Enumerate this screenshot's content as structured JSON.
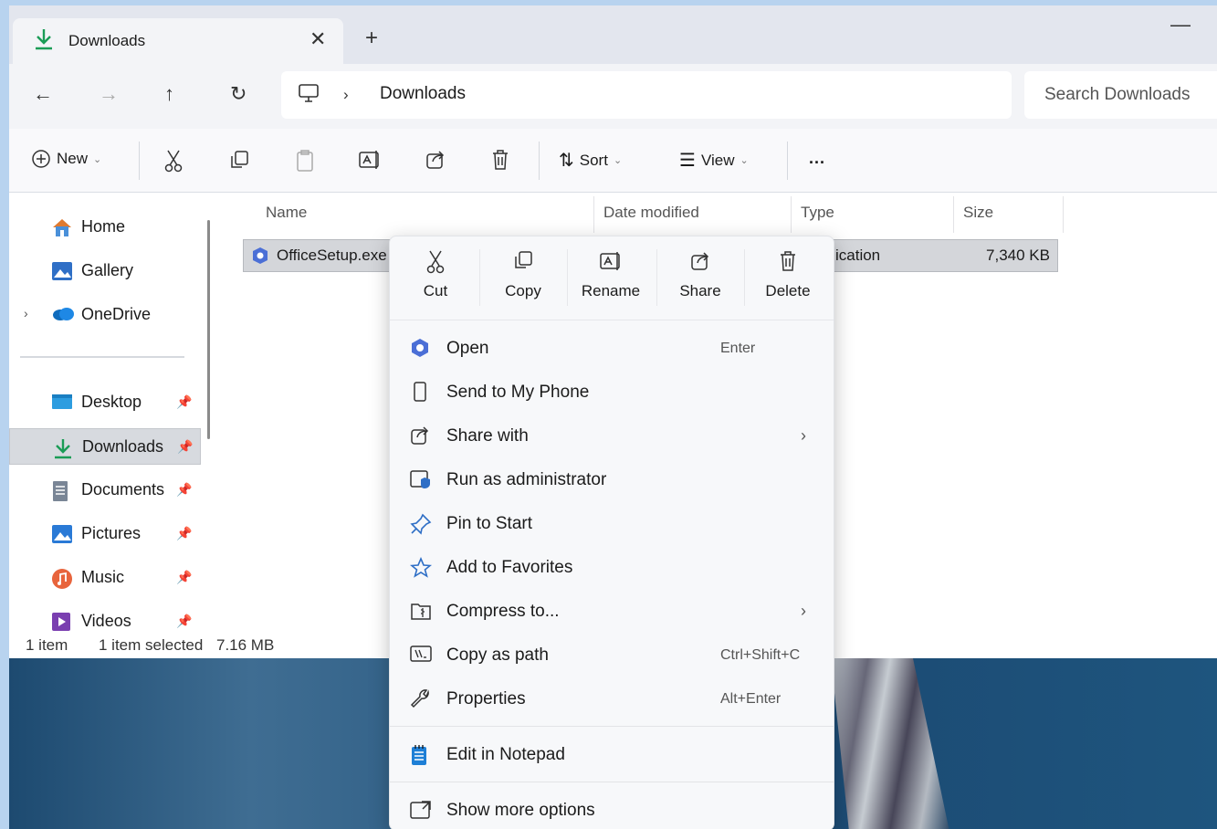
{
  "tab": {
    "title": "Downloads"
  },
  "address": {
    "crumb": "Downloads",
    "search_placeholder": "Search Downloads"
  },
  "toolbar": {
    "new_label": "New",
    "sort_label": "Sort",
    "view_label": "View",
    "more_label": "..."
  },
  "sidebar": {
    "items": [
      {
        "label": "Home",
        "icon": "home-icon"
      },
      {
        "label": "Gallery",
        "icon": "gallery-icon"
      },
      {
        "label": "OneDrive",
        "icon": "cloud-icon"
      },
      {
        "label": "Desktop",
        "icon": "desktop-icon"
      },
      {
        "label": "Downloads",
        "icon": "download-icon"
      },
      {
        "label": "Documents",
        "icon": "document-icon"
      },
      {
        "label": "Pictures",
        "icon": "pictures-icon"
      },
      {
        "label": "Music",
        "icon": "music-icon"
      },
      {
        "label": "Videos",
        "icon": "videos-icon"
      }
    ]
  },
  "columns": {
    "name": "Name",
    "date": "Date modified",
    "type": "Type",
    "size": "Size"
  },
  "file": {
    "name": "OfficeSetup.exe",
    "type": "ication",
    "size": "7,340 KB"
  },
  "status": {
    "count": "1 item",
    "selected": "1 item selected",
    "size": "7.16 MB"
  },
  "menu": {
    "top": [
      {
        "label": "Cut",
        "icon": "scissors-icon"
      },
      {
        "label": "Copy",
        "icon": "copy-icon"
      },
      {
        "label": "Rename",
        "icon": "rename-icon"
      },
      {
        "label": "Share",
        "icon": "share-icon"
      },
      {
        "label": "Delete",
        "icon": "trash-icon"
      }
    ],
    "items": [
      {
        "label": "Open",
        "shortcut": "Enter"
      },
      {
        "label": "Send to My Phone",
        "shortcut": ""
      },
      {
        "label": "Share with",
        "shortcut": ""
      },
      {
        "label": "Run as administrator",
        "shortcut": ""
      },
      {
        "label": "Pin to Start",
        "shortcut": ""
      },
      {
        "label": "Add to Favorites",
        "shortcut": ""
      },
      {
        "label": "Compress to...",
        "shortcut": ""
      },
      {
        "label": "Copy as path",
        "shortcut": "Ctrl+Shift+C"
      },
      {
        "label": "Properties",
        "shortcut": "Alt+Enter"
      },
      {
        "label": "Edit in Notepad",
        "shortcut": ""
      },
      {
        "label": "Show more options",
        "shortcut": ""
      }
    ]
  },
  "colors": {
    "accent": "#1a9c56",
    "selection": "#d4d6da",
    "menu_bg": "#f7f8fa"
  }
}
